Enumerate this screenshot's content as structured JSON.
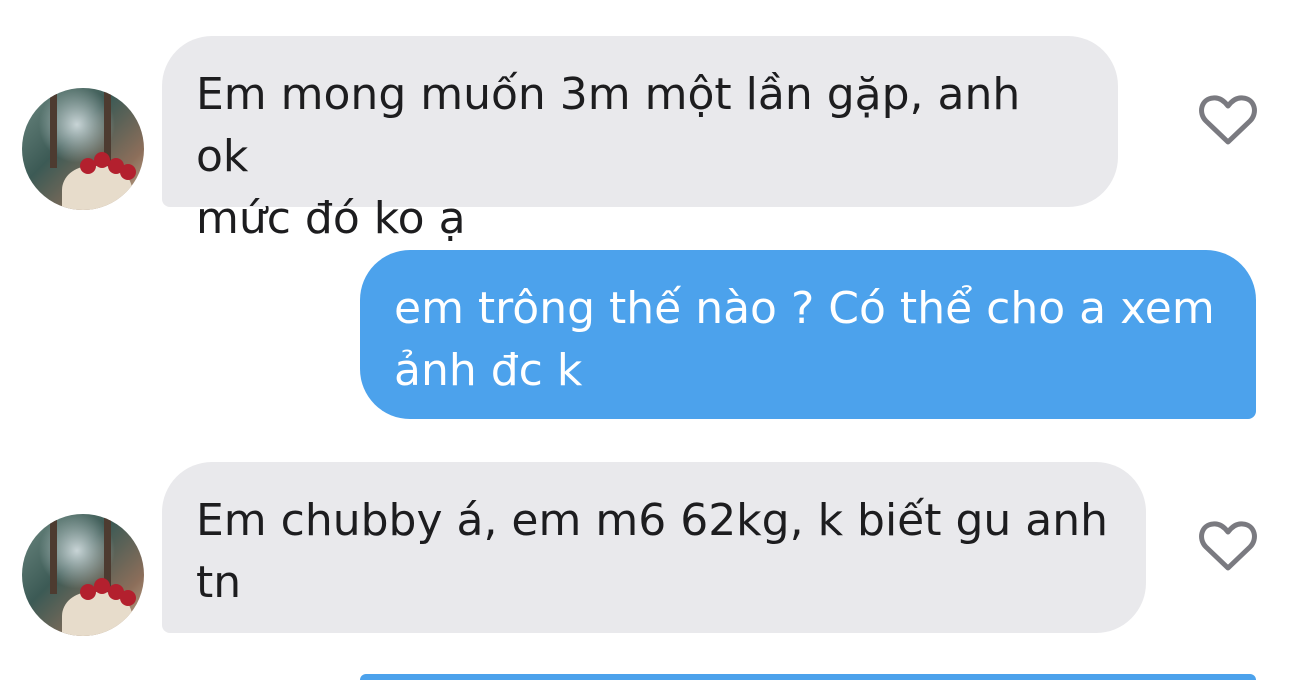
{
  "messages": [
    {
      "direction": "incoming",
      "text": "Em mong muốn 3m một lần gặp, anh ok\nmức đó ko ạ"
    },
    {
      "direction": "outgoing",
      "text": "em trông thế nào ? Có thể cho a xem\nảnh đc k"
    },
    {
      "direction": "incoming",
      "text": "Em chubby á, em m6 62kg, k biết gu anh\ntn"
    },
    {
      "direction": "outgoing",
      "text": ""
    }
  ],
  "icons": {
    "avatar": "avatar",
    "like": "heart-outline-icon"
  },
  "colors": {
    "incoming_bubble": "#e9e9ec",
    "outgoing_bubble": "#4ca2ec",
    "incoming_text": "#1d1d1f",
    "outgoing_text": "#ffffff",
    "heart_stroke": "#7a7a80"
  }
}
